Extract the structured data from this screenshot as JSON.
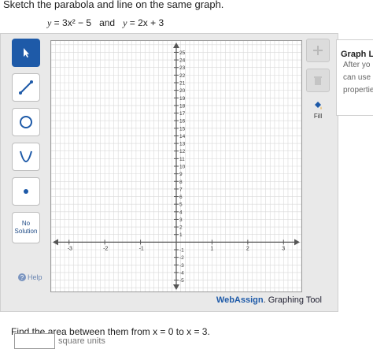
{
  "prompt": "Sketch the parabola and line on the same graph.",
  "equation": {
    "y1_left": "y",
    "y1_rhs": "= 3x² − 5",
    "and": "and",
    "y2_left": "y",
    "y2_rhs": "= 2x + 3"
  },
  "toolbar": {
    "no_solution": "No Solution",
    "help": "Help",
    "fill": "Fill"
  },
  "watermark": {
    "brand": "WebAssign",
    "suffix": ". Graphing Tool"
  },
  "side_panel": {
    "title": "Graph La",
    "lines": [
      "After yo",
      "can use",
      "propertie"
    ]
  },
  "question": "Find the area between them from x = 0 to x = 3.",
  "answer": {
    "unit": "square units"
  },
  "axes": {
    "x_ticks": [
      "-3",
      "-2",
      "-1",
      "1",
      "2",
      "3"
    ],
    "y_ticks": [
      "25",
      "24",
      "23",
      "22",
      "21",
      "20",
      "19",
      "18",
      "17",
      "16",
      "15",
      "14",
      "13",
      "12",
      "11",
      "10",
      "9",
      "8",
      "7",
      "6",
      "5",
      "4",
      "3",
      "2",
      "1",
      "-1",
      "-2",
      "-3",
      "-4",
      "-5"
    ]
  },
  "colors": {
    "accent": "#1e5aa8",
    "panel": "#e9e9e9"
  }
}
